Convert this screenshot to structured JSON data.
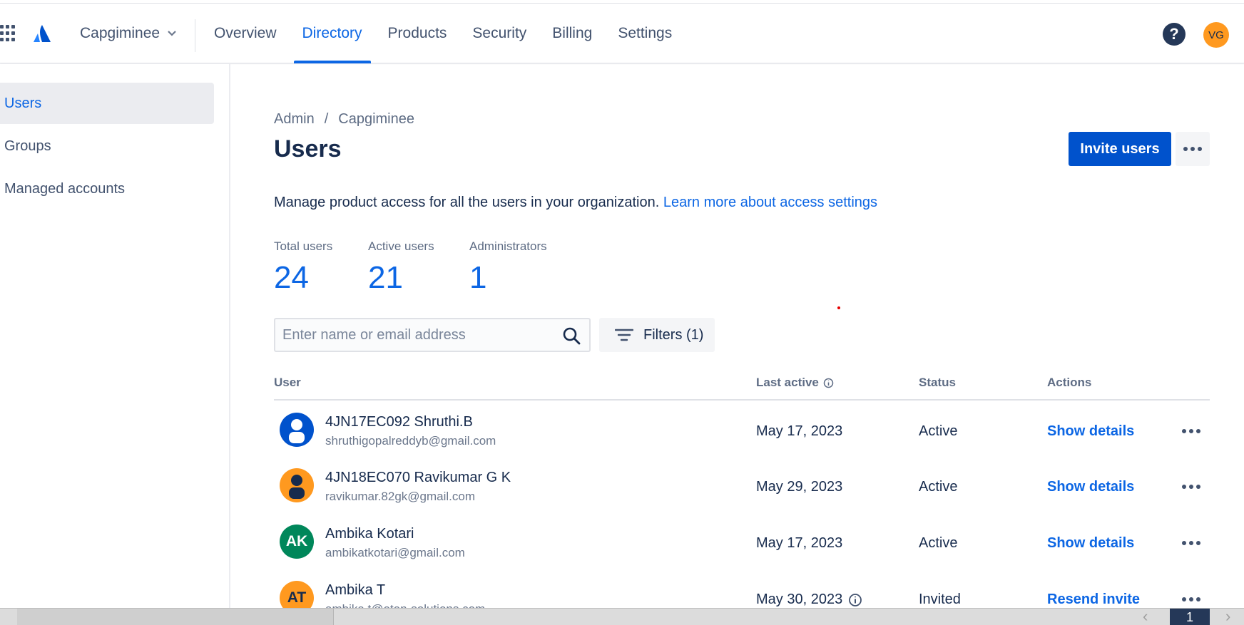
{
  "header": {
    "org_name": "Capgiminee",
    "tabs": [
      {
        "label": "Overview"
      },
      {
        "label": "Directory"
      },
      {
        "label": "Products"
      },
      {
        "label": "Security"
      },
      {
        "label": "Billing"
      },
      {
        "label": "Settings"
      }
    ],
    "active_tab": "Directory",
    "help_glyph": "?",
    "user_initials": "VG"
  },
  "sidebar": {
    "items": [
      {
        "label": "Users"
      },
      {
        "label": "Groups"
      },
      {
        "label": "Managed accounts"
      }
    ],
    "active": "Users"
  },
  "breadcrumb": {
    "items": [
      "Admin",
      "Capgiminee"
    ],
    "separator": "/"
  },
  "page": {
    "title": "Users",
    "invite_label": "Invite users",
    "description": "Manage product access for all the users in your organization.",
    "description_link": "Learn more about access settings"
  },
  "stats": [
    {
      "label": "Total users",
      "value": "24"
    },
    {
      "label": "Active users",
      "value": "21"
    },
    {
      "label": "Administrators",
      "value": "1"
    }
  ],
  "search": {
    "placeholder": "Enter name or email address",
    "value": ""
  },
  "filters": {
    "label": "Filters (1)"
  },
  "table": {
    "columns": [
      "User",
      "Last active",
      "Status",
      "Actions"
    ],
    "rows": [
      {
        "initials": "",
        "avatar_type": "icon",
        "avatar_color": "#0052cc",
        "name": "4JN17EC092 Shruthi.B",
        "email": "shruthigopalreddyb@gmail.com",
        "last_active": "May 17, 2023",
        "status": "Active",
        "action": "Show details"
      },
      {
        "initials": "",
        "avatar_type": "icon",
        "avatar_color": "#ff991f",
        "name": "4JN18EC070 Ravikumar G K",
        "email": "ravikumar.82gk@gmail.com",
        "last_active": "May 29, 2023",
        "status": "Active",
        "action": "Show details"
      },
      {
        "initials": "AK",
        "avatar_type": "initials",
        "avatar_color": "#00875a",
        "name": "Ambika Kotari",
        "email": "ambikatkotari@gmail.com",
        "last_active": "May 17, 2023",
        "status": "Active",
        "action": "Show details"
      },
      {
        "initials": "AT",
        "avatar_type": "initials",
        "avatar_color": "#ff991f",
        "name": "Ambika T",
        "email": "ambika.t@oton-solutions.com",
        "last_active": "May 30, 2023",
        "status": "Invited",
        "action": "Resend invite"
      }
    ]
  },
  "pagination": {
    "current_page": "1"
  },
  "colors": {
    "primary": "#0052cc",
    "link": "#0c66e4",
    "text": "#172b4d",
    "subtle": "#5e6c84"
  }
}
